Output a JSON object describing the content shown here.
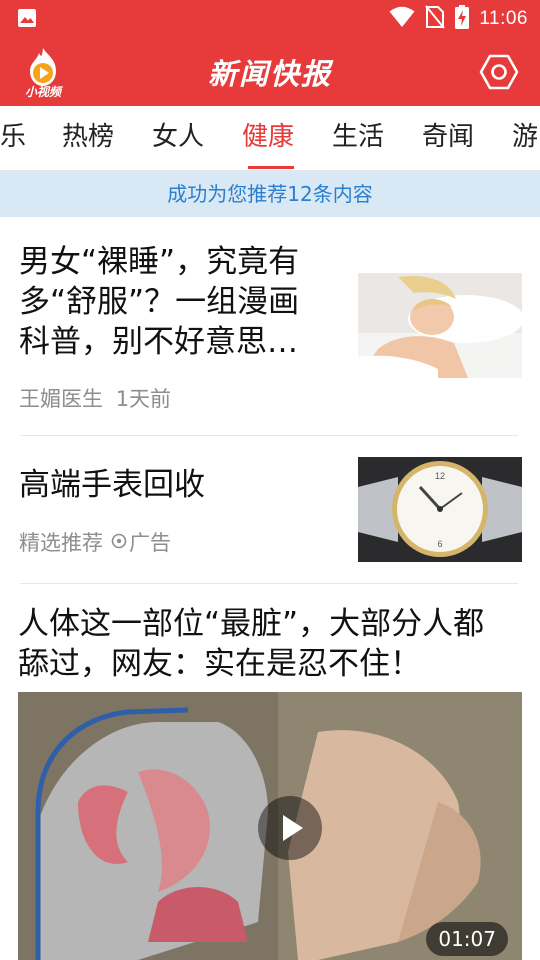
{
  "status_bar": {
    "time": "11:06",
    "icons": [
      "image-icon",
      "wifi-icon",
      "no-sim-icon",
      "battery-charging-icon"
    ]
  },
  "app_bar": {
    "logo_text": "小视频",
    "title": "新闻快报",
    "settings_icon": "settings-hexagon-icon",
    "brand_color": "#e63a3b"
  },
  "tabs": {
    "items": [
      {
        "label": "乐"
      },
      {
        "label": "热榜"
      },
      {
        "label": "女人"
      },
      {
        "label": "健康"
      },
      {
        "label": "生活"
      },
      {
        "label": "奇闻"
      },
      {
        "label": "游"
      }
    ],
    "active_index": 3
  },
  "notice": {
    "text": "成功为您推荐12条内容"
  },
  "feed": {
    "article1": {
      "title_line1": "男女“裸睡”，究竟有",
      "title_line2": "多“舒服”？一组漫画",
      "title_line3": "科普，别不好意思…",
      "source": "王媚医生",
      "time": "1天前"
    },
    "ad": {
      "title": "高端手表回收",
      "source": "精选推荐",
      "ad_label": "广告"
    },
    "video": {
      "title_line1": "人体这一部位“最脏”，大部分人都",
      "title_line2": "舔过，网友：实在是忍不住！",
      "duration": "01:07"
    }
  }
}
